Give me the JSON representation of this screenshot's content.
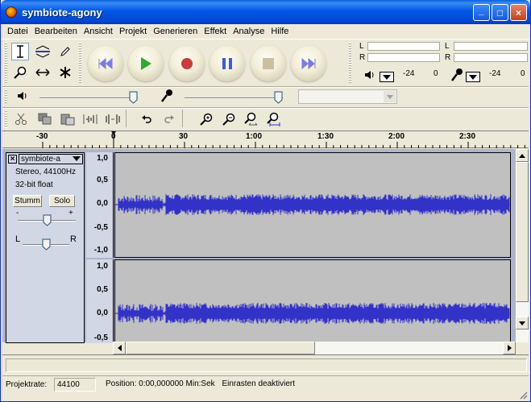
{
  "window": {
    "title": "symbiote-agony",
    "minimize": "_",
    "maximize": "□",
    "close": "×"
  },
  "menu": [
    "Datei",
    "Bearbeiten",
    "Ansicht",
    "Projekt",
    "Generieren",
    "Effekt",
    "Analyse",
    "Hilfe"
  ],
  "tools": [
    "selection-tool",
    "envelope-tool",
    "draw-tool",
    "zoom-tool",
    "timeshift-tool",
    "multi-tool"
  ],
  "transport": [
    "skip-to-start",
    "play",
    "record",
    "pause",
    "stop",
    "skip-to-end"
  ],
  "meters": {
    "left_channel": "L",
    "right_channel": "R",
    "play_min": "-24",
    "play_max": "0",
    "rec_min": "-24",
    "rec_max": "0"
  },
  "mixer": {
    "output_volume": 0.92,
    "input_volume": 0.92,
    "input_source": ""
  },
  "ruler": {
    "labels": [
      "-30",
      "0",
      "30",
      "1:00",
      "1:30",
      "2:00",
      "2:30"
    ]
  },
  "track": {
    "name": "symbiote-a",
    "info_line1": "Stereo, 44100Hz",
    "info_line2": "32-bit float",
    "mute_label": "Stumm",
    "solo_label": "Solo",
    "gain_minus": "-",
    "gain_plus": "+",
    "gain": 0.5,
    "pan_left": "L",
    "pan_right": "R",
    "pan": 0.5,
    "ticks_top": [
      "1,0",
      "0,5",
      "0,0",
      "-0,5",
      "-1,0"
    ],
    "ticks_bottom": [
      "1,0",
      "0,5",
      "0,0",
      "-0,5"
    ]
  },
  "status": {
    "rate_label": "Projektrate:",
    "rate_value": "44100",
    "position": "Position: 0:00,000000 Min:Sek",
    "snap": "Einrasten deaktiviert"
  },
  "colors": {
    "waveform": "#3232c8",
    "title_bar": "#0058e6",
    "track_bg": "#d2d7e6"
  }
}
